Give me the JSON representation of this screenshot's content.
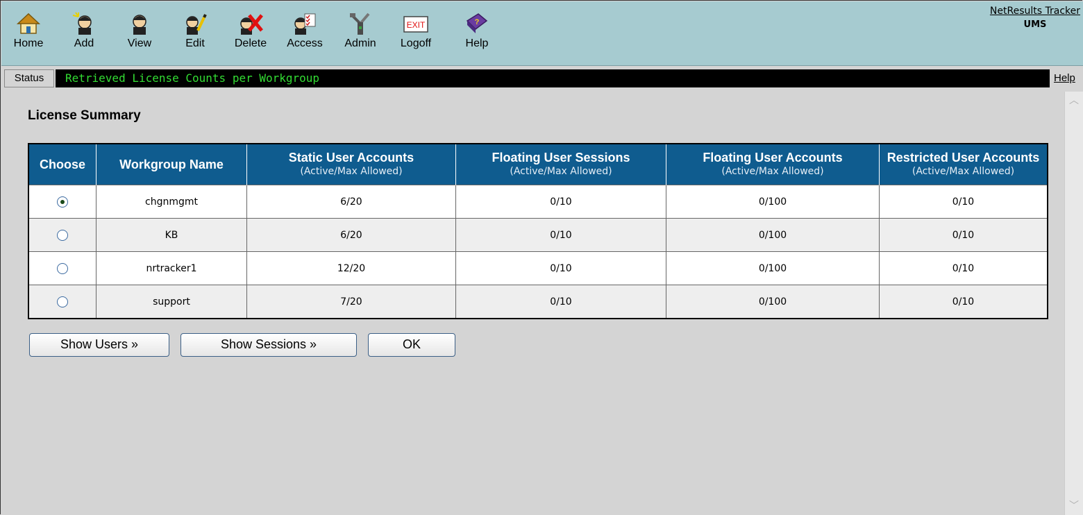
{
  "toolbar": {
    "items": [
      {
        "label": "Home",
        "icon": "home-icon"
      },
      {
        "label": "Add",
        "icon": "add-icon"
      },
      {
        "label": "View",
        "icon": "view-icon"
      },
      {
        "label": "Edit",
        "icon": "edit-icon"
      },
      {
        "label": "Delete",
        "icon": "delete-icon"
      },
      {
        "label": "Access",
        "icon": "access-icon"
      },
      {
        "label": "Admin",
        "icon": "admin-icon"
      },
      {
        "label": "Logoff",
        "icon": "logoff-icon"
      },
      {
        "label": "Help",
        "icon": "help-book-icon"
      }
    ],
    "exit_text": "EXIT",
    "brand_name": "NetResults Tracker",
    "brand_sub": "UMS"
  },
  "status": {
    "label": "Status",
    "message": "Retrieved License Counts per Workgroup",
    "help": "Help"
  },
  "page": {
    "title": "License Summary"
  },
  "table": {
    "headers": [
      {
        "title": "Choose",
        "sub": ""
      },
      {
        "title": "Workgroup Name",
        "sub": ""
      },
      {
        "title": "Static User Accounts",
        "sub": "(Active/Max Allowed)"
      },
      {
        "title": "Floating User Sessions",
        "sub": "(Active/Max Allowed)"
      },
      {
        "title": "Floating User Accounts",
        "sub": "(Active/Max Allowed)"
      },
      {
        "title": "Restricted User Accounts",
        "sub": "(Active/Max Allowed)"
      }
    ],
    "rows": [
      {
        "selected": true,
        "workgroup": "chgnmgmt",
        "static": "6/20",
        "floating_sessions": "0/10",
        "floating_accounts": "0/100",
        "restricted": "0/10"
      },
      {
        "selected": false,
        "workgroup": "KB",
        "static": "6/20",
        "floating_sessions": "0/10",
        "floating_accounts": "0/100",
        "restricted": "0/10"
      },
      {
        "selected": false,
        "workgroup": "nrtracker1",
        "static": "12/20",
        "floating_sessions": "0/10",
        "floating_accounts": "0/100",
        "restricted": "0/10"
      },
      {
        "selected": false,
        "workgroup": "support",
        "static": "7/20",
        "floating_sessions": "0/10",
        "floating_accounts": "0/100",
        "restricted": "0/10"
      }
    ]
  },
  "buttons": {
    "show_users": "Show Users »",
    "show_sessions": "Show Sessions »",
    "ok": "OK"
  },
  "colors": {
    "toolbar_bg": "#a6cbd0",
    "header_bg": "#0f5c8f",
    "status_text": "#33dd33",
    "page_bg": "#d4d4d4"
  }
}
